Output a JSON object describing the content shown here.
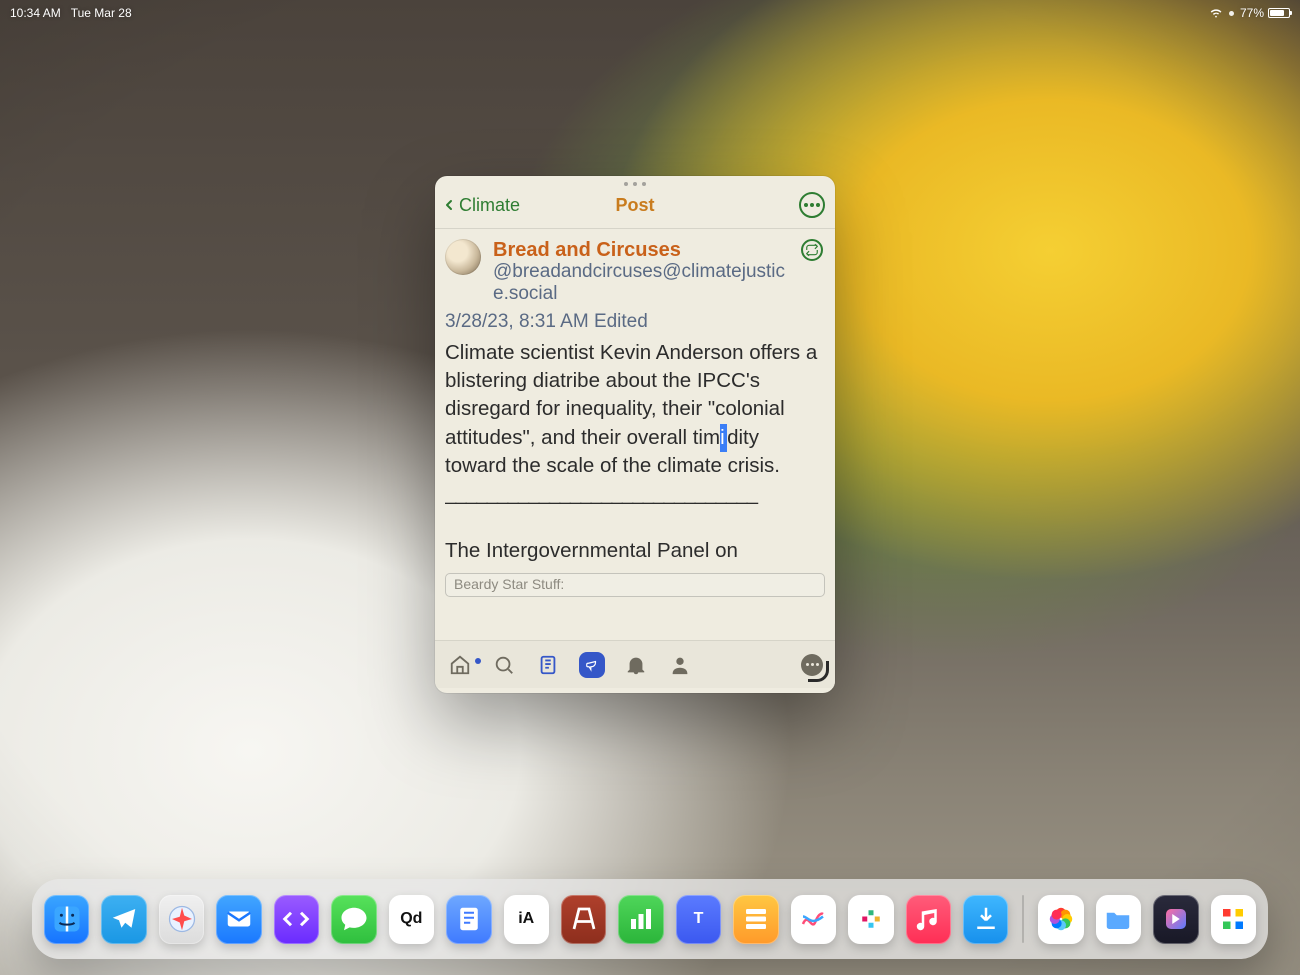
{
  "statusbar": {
    "time": "10:34 AM",
    "date": "Tue Mar 28",
    "battery_percent": "77%",
    "battery_level_pct": 77
  },
  "window": {
    "back_label": "Climate",
    "title": "Post",
    "post": {
      "display_name": "Bread and Circuses",
      "handle": "@breadandcircuses@climatejustice.social",
      "timestamp": "3/28/23, 8:31 AM Edited",
      "body_before": "Climate scientist Kevin Anderson offers a blistering diatribe about the IPCC's disregard for inequality, their \"colonial attitudes\", and their overall tim",
      "body_caret": "i",
      "body_after": "dity toward the scale of the climate crisis.",
      "separator": "______________________________",
      "body_more": "The Intergovernmental Panel on",
      "search_placeholder": "Beardy Star Stuff:"
    },
    "tabs": {
      "home": "home",
      "search": "search",
      "lists": "lists",
      "announcements": "announcements",
      "notifications": "notifications",
      "profile": "profile",
      "more": "more"
    }
  },
  "dock": {
    "apps_left": [
      {
        "name": "finder-app",
        "label": ""
      },
      {
        "name": "telegram-app",
        "label": ""
      },
      {
        "name": "safari-app",
        "label": ""
      },
      {
        "name": "mail-app",
        "label": ""
      },
      {
        "name": "code-app",
        "label": ""
      },
      {
        "name": "messages-app",
        "label": ""
      },
      {
        "name": "qd-app",
        "label": "Qd"
      },
      {
        "name": "notes-app",
        "label": ""
      },
      {
        "name": "ia-app",
        "label": "iA"
      },
      {
        "name": "pages-app",
        "label": ""
      },
      {
        "name": "numbers-app",
        "label": ""
      },
      {
        "name": "t-app",
        "label": "T"
      },
      {
        "name": "reminders-app",
        "label": ""
      },
      {
        "name": "freeform-app",
        "label": ""
      },
      {
        "name": "slack-app",
        "label": ""
      },
      {
        "name": "music-app",
        "label": ""
      },
      {
        "name": "download-app",
        "label": ""
      }
    ],
    "apps_right": [
      {
        "name": "photos-app",
        "label": ""
      },
      {
        "name": "files-app",
        "label": ""
      },
      {
        "name": "shortcuts-app",
        "label": ""
      },
      {
        "name": "grid-app",
        "label": ""
      }
    ]
  }
}
